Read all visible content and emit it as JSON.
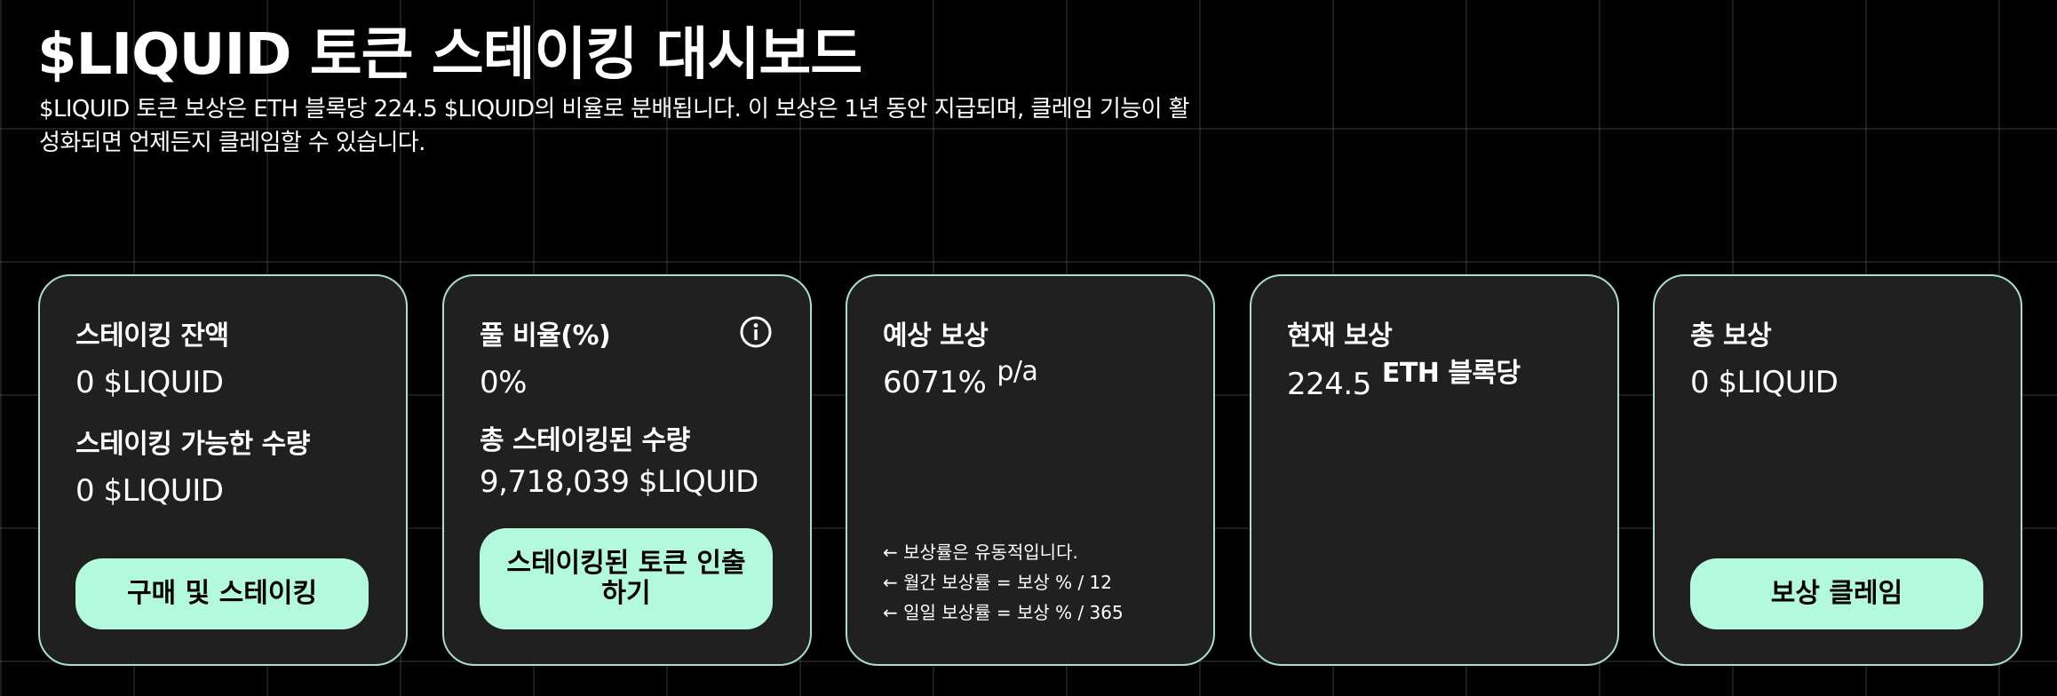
{
  "header": {
    "title": "$LIQUID 토큰 스테이킹 대시보드",
    "description": "$LIQUID 토큰 보상은 ETH 블록당 224.5 $LIQUID의 비율로 분배됩니다. 이 보상은 1년 동안 지급되며, 클레임 기능이 활성화되면 언제든지 클레임할 수 있습니다."
  },
  "cards": {
    "staking": {
      "balance_label": "스테이킹 잔액",
      "balance_value": "0 $LIQUID",
      "available_label": "스테이킹 가능한 수량",
      "available_value": "0 $LIQUID",
      "button_label": "구매 및 스테이킹"
    },
    "pool": {
      "ratio_label": "풀 비율(%)",
      "ratio_value": "0%",
      "total_label": "총 스테이킹된 수량",
      "total_value": "9,718,039 $LIQUID",
      "button_label": "스테이킹된 토큰 인출하기",
      "info_icon": "info-icon"
    },
    "expected": {
      "label": "예상 보상",
      "value": "6071%",
      "unit": "p/a",
      "notes": [
        "← 보상률은 유동적입니다.",
        "← 월간 보상률 = 보상 % / 12",
        "← 일일 보상률 = 보상 % / 365"
      ]
    },
    "current": {
      "label": "현재 보상",
      "value": "224.5",
      "unit": "ETH 블록당"
    },
    "total": {
      "label": "총 보상",
      "value": "0 $LIQUID",
      "button_label": "보상 클레임"
    }
  },
  "colors": {
    "background": "#000000",
    "card": "#202020",
    "card_border": "#a7dfca",
    "button": "#b3f9de",
    "button_text": "#000000"
  }
}
